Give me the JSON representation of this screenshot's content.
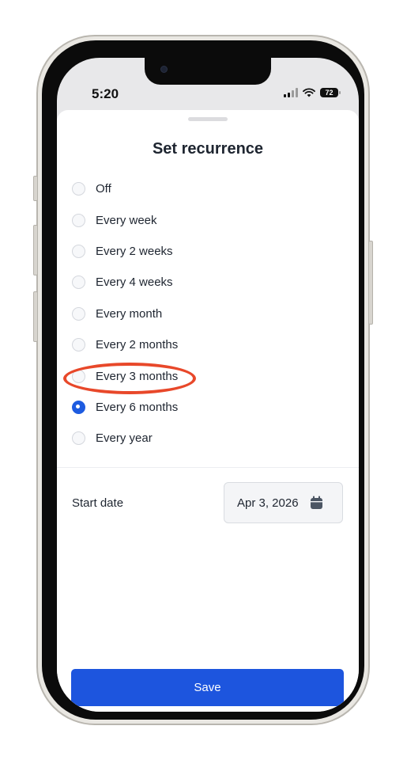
{
  "status_bar": {
    "time": "5:20",
    "battery": "72"
  },
  "sheet": {
    "title": "Set recurrence"
  },
  "options": [
    {
      "label": "Off",
      "selected": false
    },
    {
      "label": "Every week",
      "selected": false
    },
    {
      "label": "Every 2 weeks",
      "selected": false
    },
    {
      "label": "Every 4 weeks",
      "selected": false
    },
    {
      "label": "Every month",
      "selected": false
    },
    {
      "label": "Every 2 months",
      "selected": false
    },
    {
      "label": "Every 3 months",
      "selected": false
    },
    {
      "label": "Every 6 months",
      "selected": true
    },
    {
      "label": "Every year",
      "selected": false
    }
  ],
  "start_date": {
    "label": "Start date",
    "value": "Apr 3, 2026",
    "icon": "calendar-icon"
  },
  "save_label": "Save",
  "colors": {
    "accent": "#1d55de",
    "annotation": "#e8482a"
  }
}
